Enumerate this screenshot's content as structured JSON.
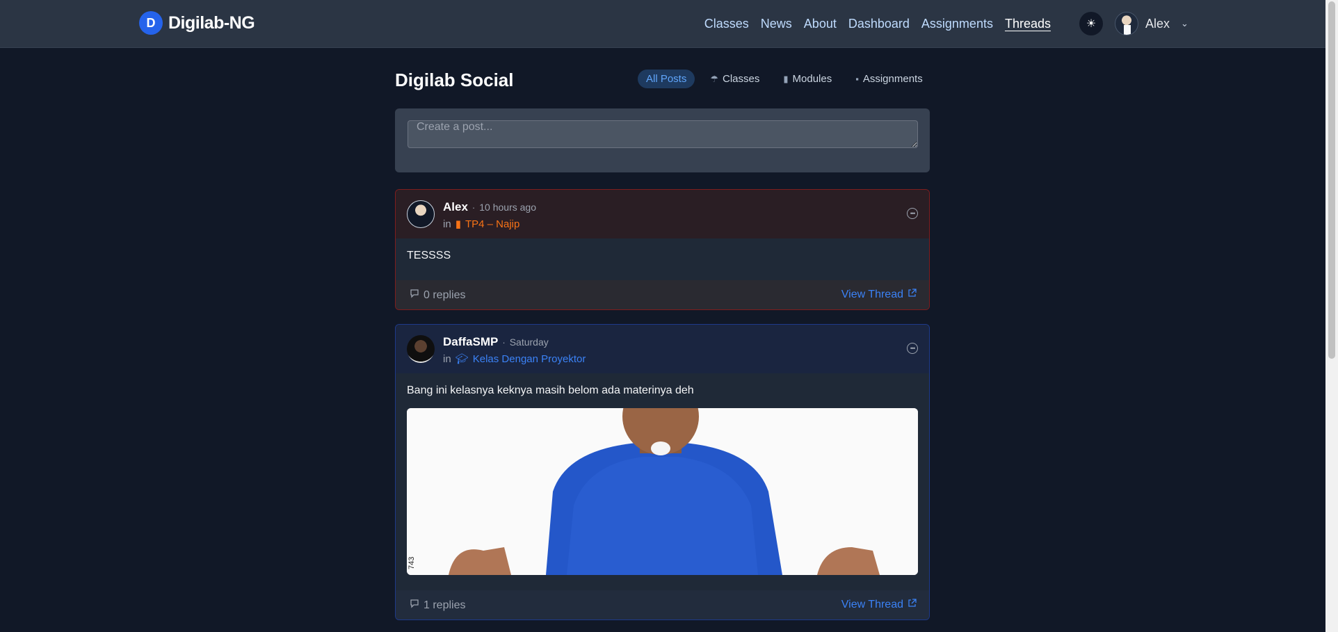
{
  "brand": {
    "name": "Digilab-NG",
    "logo_letter": "D"
  },
  "nav": {
    "links": [
      "Classes",
      "News",
      "About",
      "Dashboard",
      "Assignments",
      "Threads"
    ],
    "active": "Threads",
    "theme_icon": "sun-icon",
    "user": "Alex"
  },
  "page": {
    "title": "Digilab Social",
    "filters": [
      {
        "label": "All Posts",
        "icon": "",
        "active": true
      },
      {
        "label": "Classes",
        "icon": "umbrella-icon",
        "active": false
      },
      {
        "label": "Modules",
        "icon": "book-icon",
        "active": false
      },
      {
        "label": "Assignments",
        "icon": "monitor-icon",
        "active": false
      }
    ],
    "create_placeholder": "Create a post..."
  },
  "posts": [
    {
      "author": "Alex",
      "time": "10 hours ago",
      "in_label": "in",
      "location": "TP4 – Najip",
      "location_icon": "file-icon",
      "location_color": "#f97316",
      "body": "TESSSS",
      "replies": "0 replies",
      "view_label": "View Thread"
    },
    {
      "author": "DaffaSMP",
      "time": "Saturday",
      "in_label": "in",
      "location": "Kelas Dengan Proyektor",
      "location_icon": "graduation-cap-icon",
      "location_color": "#3b82f6",
      "body": "Bang ini kelasnya keknya masih belom ada materinya deh",
      "image_caption": "743",
      "replies": "1 replies",
      "view_label": "View Thread"
    }
  ],
  "colors": {
    "accent": "#3b82f6",
    "background": "#111827",
    "navbar": "#2b3544"
  }
}
